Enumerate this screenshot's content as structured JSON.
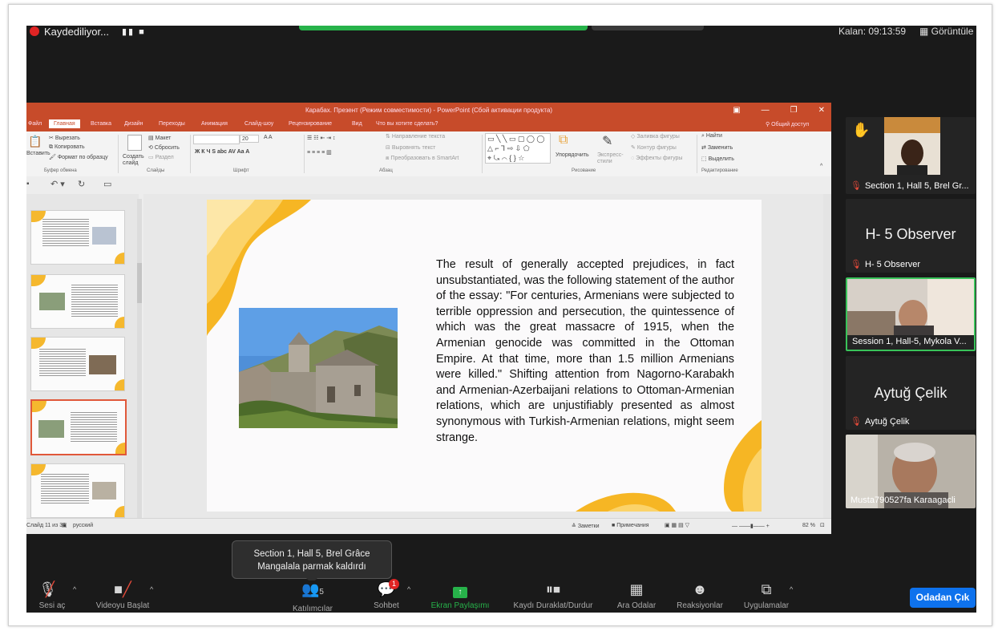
{
  "zoom": {
    "recording_label": "Kaydediliyor...",
    "timer": "Kalan: 09:13:59",
    "view_label": "Görüntüle",
    "tooltip_line1": "Section 1, Hall 5, Brel Grâce",
    "tooltip_line2": "Mangalala parmak kaldırdı",
    "participants_count": "5",
    "chat_badge": "1",
    "leave_label": "Odadan Çık",
    "toolbar": {
      "audio_label": "Sesi aç",
      "video_label": "Videoyu Başlat",
      "participants_label": "Katılımcılar",
      "chat_label": "Sohbet",
      "share_label": "Ekran Paylaşımı",
      "pause_label": "Kaydı Duraklat/Durdur",
      "rooms_label": "Ara Odalar",
      "reactions_label": "Reaksiyonlar",
      "apps_label": "Uygulamalar"
    },
    "tiles": [
      {
        "name": "Section 1, Hall 5, Brel Gr..."
      },
      {
        "big": "H- 5 Observer",
        "name": "H- 5 Observer"
      },
      {
        "name": "Session 1, Hall-5, Mykola V..."
      },
      {
        "big": "Aytuğ Çelik",
        "name": "Aytuğ Çelik"
      },
      {
        "name": "Musta790527fa Karaagacli"
      }
    ]
  },
  "ppt": {
    "title": "Карабах. Презент (Режим совместимости) - PowerPoint (Сбой активации продукта)",
    "share_label": "Общий доступ",
    "tabs": [
      "Файл",
      "Главная",
      "Вставка",
      "Дизайн",
      "Переходы",
      "Анимация",
      "Слайд-шоу",
      "Рецензирование",
      "Вид",
      "Что вы хотите сделать?"
    ],
    "ribbon": {
      "cut": "Вырезать",
      "copy": "Копировать",
      "format_painter": "Формат по образцу",
      "paste": "Вставить",
      "create_slide": "Создать слайд",
      "layout": "Макет",
      "reset": "Сбросить",
      "section": "Раздел",
      "font_size": "20",
      "text_direction": "Направление текста",
      "align_text": "Выровнять текст",
      "smartart": "Преобразовать в SmartArt",
      "arrange": "Упорядочить",
      "quick_styles": "Экспресс-стили",
      "fill": "Заливка фигуры",
      "outline": "Контур фигуры",
      "effects": "Эффекты фигуры",
      "find": "Найти",
      "replace": "Заменить",
      "select": "Выделить",
      "grp_clipboard": "Буфер обмена",
      "grp_slides": "Слайды",
      "grp_font": "Шрифт",
      "grp_paragraph": "Абзац",
      "grp_drawing": "Рисование",
      "grp_editing": "Редактирование"
    },
    "slide_text": "The result of generally accepted prejudices, in fact unsubstantiated, was the following statement of the author of the essay: \"For centuries, Armenians were subjected to terrible oppression and persecution, the quintessence of which was the great massacre of 1915, when the Armenian genocide was committed in the Ottoman Empire. At that time, more than 1.5 million Armenians were killed.\" Shifting attention from Nagorno-Karabakh and Armenian-Azerbaijani relations to Ottoman-Armenian relations, which are unjustifiably presented as almost synonymous with Turkish-Armenian relations, might seem strange.",
    "status_slide": "Слайд 11 из 36",
    "status_lang": "русский",
    "status_notes": "Заметки",
    "status_comments": "Примечания",
    "zoom_pct": "82 %"
  },
  "colors": {
    "ppt_accent": "#c74b2a",
    "slide_gold": "#f5b82e",
    "zoom_bg": "#1a1a1a",
    "leave_blue": "#0e72ed",
    "share_green": "#27b24a"
  }
}
